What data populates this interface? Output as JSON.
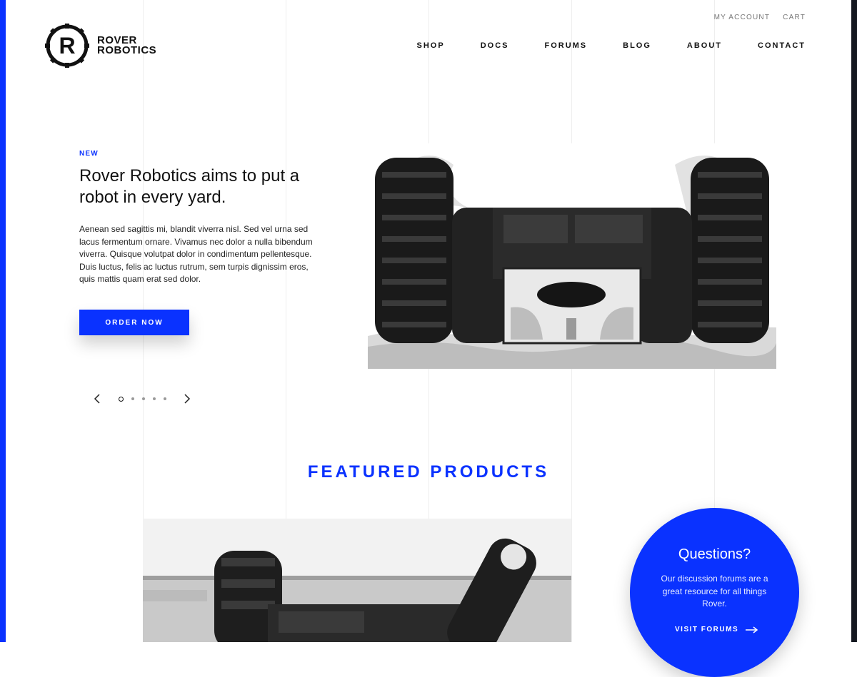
{
  "brand": {
    "line1": "ROVER",
    "line2": "ROBOTICS"
  },
  "utility_nav": [
    "MY ACCOUNT",
    "CART"
  ],
  "main_nav": [
    "SHOP",
    "DOCS",
    "FORUMS",
    "BLOG",
    "ABOUT",
    "CONTACT"
  ],
  "hero": {
    "tag": "NEW",
    "title": "Rover Robotics aims to put a robot in every yard.",
    "body": "Aenean sed sagittis mi, blandit viverra nisl. Sed vel urna sed lacus fermentum ornare. Vivamus nec dolor a nulla bibendum viverra. Quisque volutpat dolor in condimentum pellentesque. Duis luctus, felis ac luctus rutrum, sem turpis dignissim eros, quis mattis quam erat sed dolor.",
    "cta": "ORDER NOW",
    "carousel": {
      "slides": 5,
      "active": 1
    }
  },
  "featured": {
    "title": "FEATURED PRODUCTS"
  },
  "questions": {
    "title": "Questions?",
    "body": "Our discussion forums are a great resource for all things Rover.",
    "link": "VISIT FORUMS"
  },
  "colors": {
    "accent": "#0a32ff",
    "dark": "#141820"
  },
  "icons": {
    "prev": "chevron-left-icon",
    "next": "chevron-right-icon",
    "link_arrow": "arrow-right-icon"
  }
}
